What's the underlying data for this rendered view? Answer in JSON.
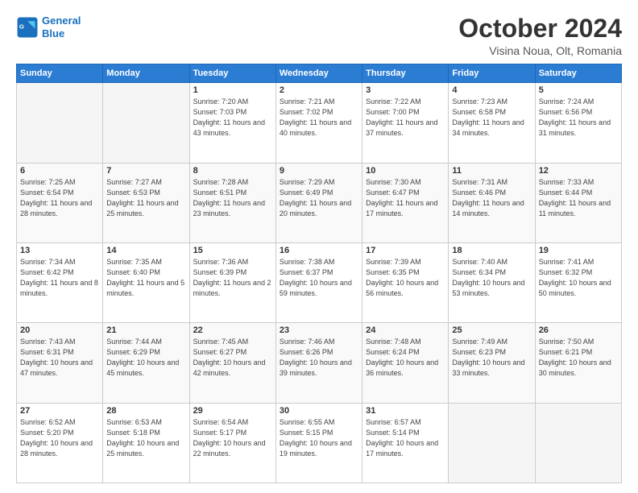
{
  "header": {
    "logo_general": "General",
    "logo_blue": "Blue",
    "month_title": "October 2024",
    "location": "Visina Noua, Olt, Romania"
  },
  "days_of_week": [
    "Sunday",
    "Monday",
    "Tuesday",
    "Wednesday",
    "Thursday",
    "Friday",
    "Saturday"
  ],
  "weeks": [
    [
      {
        "day": "",
        "empty": true
      },
      {
        "day": "",
        "empty": true
      },
      {
        "day": "1",
        "sunrise": "Sunrise: 7:20 AM",
        "sunset": "Sunset: 7:03 PM",
        "daylight": "Daylight: 11 hours and 43 minutes."
      },
      {
        "day": "2",
        "sunrise": "Sunrise: 7:21 AM",
        "sunset": "Sunset: 7:02 PM",
        "daylight": "Daylight: 11 hours and 40 minutes."
      },
      {
        "day": "3",
        "sunrise": "Sunrise: 7:22 AM",
        "sunset": "Sunset: 7:00 PM",
        "daylight": "Daylight: 11 hours and 37 minutes."
      },
      {
        "day": "4",
        "sunrise": "Sunrise: 7:23 AM",
        "sunset": "Sunset: 6:58 PM",
        "daylight": "Daylight: 11 hours and 34 minutes."
      },
      {
        "day": "5",
        "sunrise": "Sunrise: 7:24 AM",
        "sunset": "Sunset: 6:56 PM",
        "daylight": "Daylight: 11 hours and 31 minutes."
      }
    ],
    [
      {
        "day": "6",
        "sunrise": "Sunrise: 7:25 AM",
        "sunset": "Sunset: 6:54 PM",
        "daylight": "Daylight: 11 hours and 28 minutes."
      },
      {
        "day": "7",
        "sunrise": "Sunrise: 7:27 AM",
        "sunset": "Sunset: 6:53 PM",
        "daylight": "Daylight: 11 hours and 25 minutes."
      },
      {
        "day": "8",
        "sunrise": "Sunrise: 7:28 AM",
        "sunset": "Sunset: 6:51 PM",
        "daylight": "Daylight: 11 hours and 23 minutes."
      },
      {
        "day": "9",
        "sunrise": "Sunrise: 7:29 AM",
        "sunset": "Sunset: 6:49 PM",
        "daylight": "Daylight: 11 hours and 20 minutes."
      },
      {
        "day": "10",
        "sunrise": "Sunrise: 7:30 AM",
        "sunset": "Sunset: 6:47 PM",
        "daylight": "Daylight: 11 hours and 17 minutes."
      },
      {
        "day": "11",
        "sunrise": "Sunrise: 7:31 AM",
        "sunset": "Sunset: 6:46 PM",
        "daylight": "Daylight: 11 hours and 14 minutes."
      },
      {
        "day": "12",
        "sunrise": "Sunrise: 7:33 AM",
        "sunset": "Sunset: 6:44 PM",
        "daylight": "Daylight: 11 hours and 11 minutes."
      }
    ],
    [
      {
        "day": "13",
        "sunrise": "Sunrise: 7:34 AM",
        "sunset": "Sunset: 6:42 PM",
        "daylight": "Daylight: 11 hours and 8 minutes."
      },
      {
        "day": "14",
        "sunrise": "Sunrise: 7:35 AM",
        "sunset": "Sunset: 6:40 PM",
        "daylight": "Daylight: 11 hours and 5 minutes."
      },
      {
        "day": "15",
        "sunrise": "Sunrise: 7:36 AM",
        "sunset": "Sunset: 6:39 PM",
        "daylight": "Daylight: 11 hours and 2 minutes."
      },
      {
        "day": "16",
        "sunrise": "Sunrise: 7:38 AM",
        "sunset": "Sunset: 6:37 PM",
        "daylight": "Daylight: 10 hours and 59 minutes."
      },
      {
        "day": "17",
        "sunrise": "Sunrise: 7:39 AM",
        "sunset": "Sunset: 6:35 PM",
        "daylight": "Daylight: 10 hours and 56 minutes."
      },
      {
        "day": "18",
        "sunrise": "Sunrise: 7:40 AM",
        "sunset": "Sunset: 6:34 PM",
        "daylight": "Daylight: 10 hours and 53 minutes."
      },
      {
        "day": "19",
        "sunrise": "Sunrise: 7:41 AM",
        "sunset": "Sunset: 6:32 PM",
        "daylight": "Daylight: 10 hours and 50 minutes."
      }
    ],
    [
      {
        "day": "20",
        "sunrise": "Sunrise: 7:43 AM",
        "sunset": "Sunset: 6:31 PM",
        "daylight": "Daylight: 10 hours and 47 minutes."
      },
      {
        "day": "21",
        "sunrise": "Sunrise: 7:44 AM",
        "sunset": "Sunset: 6:29 PM",
        "daylight": "Daylight: 10 hours and 45 minutes."
      },
      {
        "day": "22",
        "sunrise": "Sunrise: 7:45 AM",
        "sunset": "Sunset: 6:27 PM",
        "daylight": "Daylight: 10 hours and 42 minutes."
      },
      {
        "day": "23",
        "sunrise": "Sunrise: 7:46 AM",
        "sunset": "Sunset: 6:26 PM",
        "daylight": "Daylight: 10 hours and 39 minutes."
      },
      {
        "day": "24",
        "sunrise": "Sunrise: 7:48 AM",
        "sunset": "Sunset: 6:24 PM",
        "daylight": "Daylight: 10 hours and 36 minutes."
      },
      {
        "day": "25",
        "sunrise": "Sunrise: 7:49 AM",
        "sunset": "Sunset: 6:23 PM",
        "daylight": "Daylight: 10 hours and 33 minutes."
      },
      {
        "day": "26",
        "sunrise": "Sunrise: 7:50 AM",
        "sunset": "Sunset: 6:21 PM",
        "daylight": "Daylight: 10 hours and 30 minutes."
      }
    ],
    [
      {
        "day": "27",
        "sunrise": "Sunrise: 6:52 AM",
        "sunset": "Sunset: 5:20 PM",
        "daylight": "Daylight: 10 hours and 28 minutes."
      },
      {
        "day": "28",
        "sunrise": "Sunrise: 6:53 AM",
        "sunset": "Sunset: 5:18 PM",
        "daylight": "Daylight: 10 hours and 25 minutes."
      },
      {
        "day": "29",
        "sunrise": "Sunrise: 6:54 AM",
        "sunset": "Sunset: 5:17 PM",
        "daylight": "Daylight: 10 hours and 22 minutes."
      },
      {
        "day": "30",
        "sunrise": "Sunrise: 6:55 AM",
        "sunset": "Sunset: 5:15 PM",
        "daylight": "Daylight: 10 hours and 19 minutes."
      },
      {
        "day": "31",
        "sunrise": "Sunrise: 6:57 AM",
        "sunset": "Sunset: 5:14 PM",
        "daylight": "Daylight: 10 hours and 17 minutes."
      },
      {
        "day": "",
        "empty": true
      },
      {
        "day": "",
        "empty": true
      }
    ]
  ]
}
